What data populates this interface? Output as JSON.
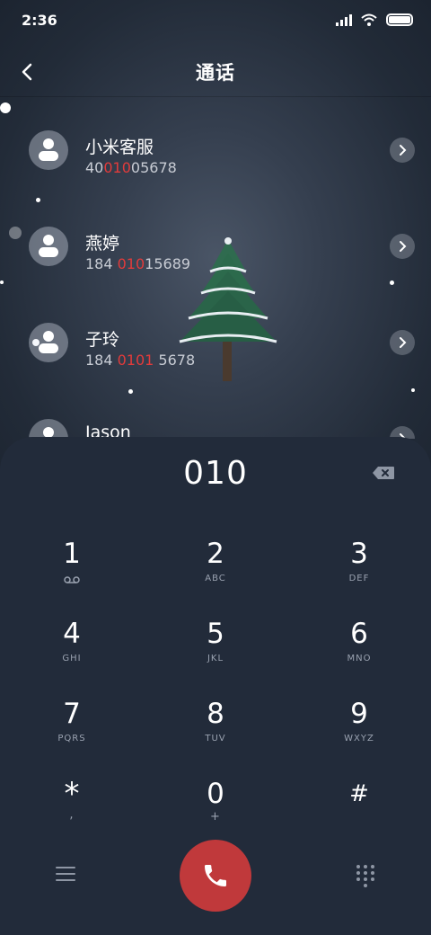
{
  "status": {
    "time": "2:36"
  },
  "header": {
    "title": "通话"
  },
  "contacts": [
    {
      "name": "小米客服",
      "num_pre": "40",
      "num_hl": "010",
      "num_post": "05678"
    },
    {
      "name": "燕婷",
      "num_pre": "184 ",
      "num_hl": "010",
      "num_post": "15689"
    },
    {
      "name": "子玲",
      "num_pre": "184 ",
      "num_hl": "0101",
      "num_post": " 5678"
    },
    {
      "name": "Jason",
      "num_pre": "",
      "num_hl": "",
      "num_post": ""
    }
  ],
  "dialpad": {
    "input": "010",
    "keys": [
      {
        "digit": "1",
        "letters": ""
      },
      {
        "digit": "2",
        "letters": "ABC"
      },
      {
        "digit": "3",
        "letters": "DEF"
      },
      {
        "digit": "4",
        "letters": "GHI"
      },
      {
        "digit": "5",
        "letters": "JKL"
      },
      {
        "digit": "6",
        "letters": "MNO"
      },
      {
        "digit": "7",
        "letters": "PQRS"
      },
      {
        "digit": "8",
        "letters": "TUV"
      },
      {
        "digit": "9",
        "letters": "WXYZ"
      },
      {
        "digit": "*",
        "letters": ","
      },
      {
        "digit": "0",
        "letters": "+"
      },
      {
        "digit": "#",
        "letters": ""
      }
    ]
  },
  "colors": {
    "highlight": "#e23b3b",
    "call_button": "#c0393b",
    "dialpad_bg": "#222b3a"
  },
  "icons": [
    "back-icon",
    "signal-icon",
    "wifi-icon",
    "battery-icon",
    "contact-avatar-icon",
    "chevron-right-icon",
    "backspace-icon",
    "voicemail-icon",
    "menu-icon",
    "phone-icon",
    "dialpad-grid-icon"
  ]
}
